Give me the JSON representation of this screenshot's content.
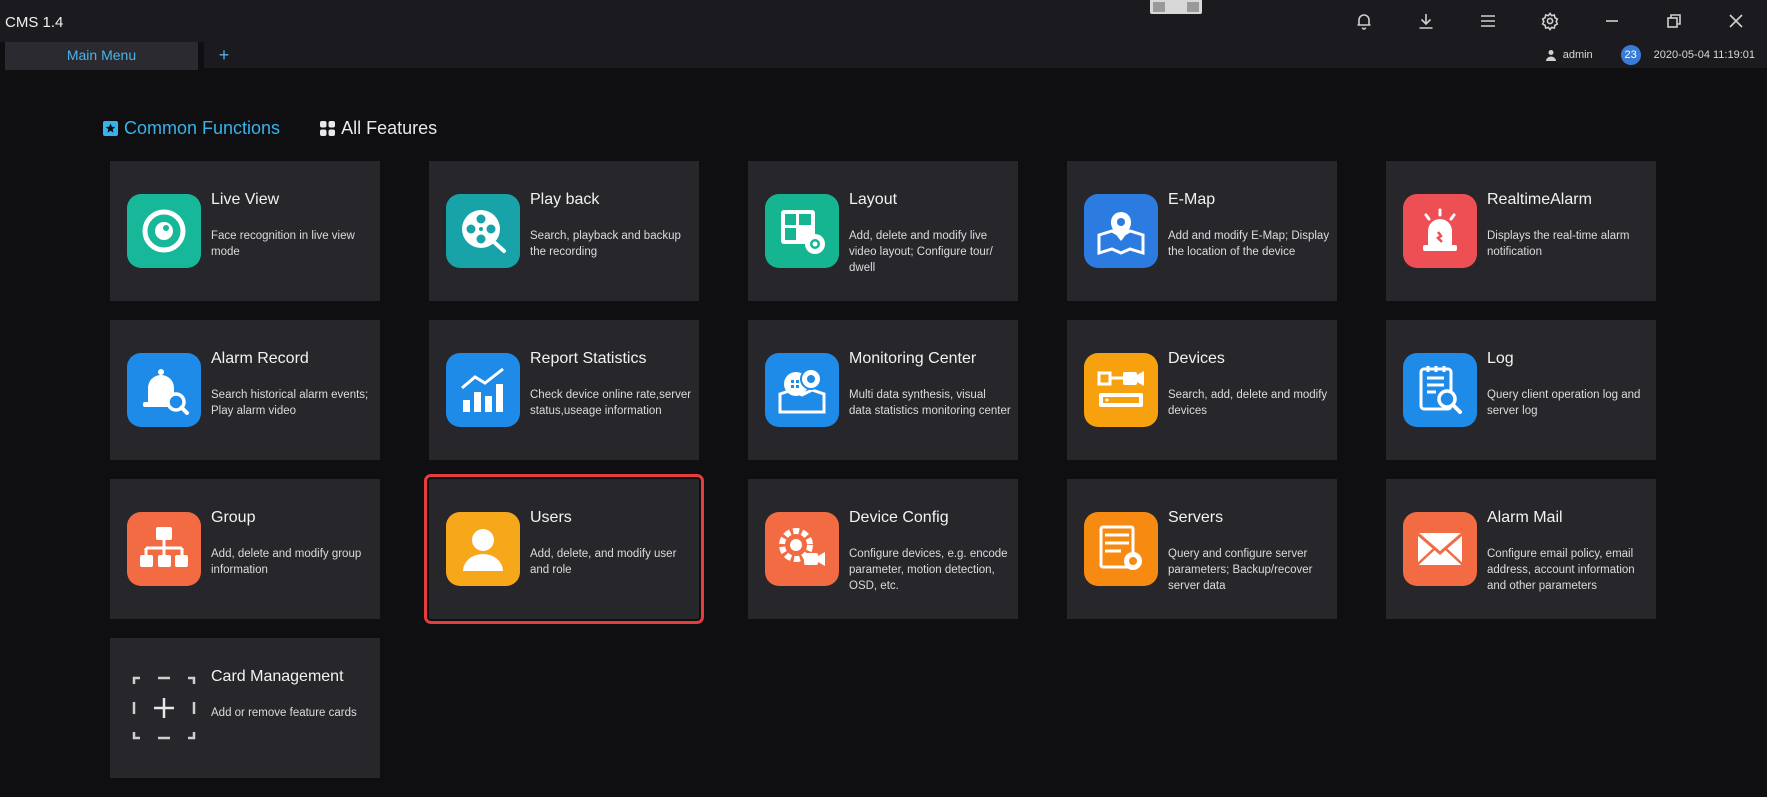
{
  "window": {
    "title": "CMS 1.4"
  },
  "toolbar_icons": [
    "bell-icon",
    "download-icon",
    "menu-icon",
    "settings-icon",
    "minimize-icon",
    "restore-icon",
    "close-icon"
  ],
  "tabs": {
    "main_label": "Main Menu",
    "add_label": "+"
  },
  "status": {
    "user": "admin",
    "badge_count": "23",
    "datetime": "2020-05-04 11:19:01"
  },
  "sections": {
    "common": "Common Functions",
    "all": "All Features"
  },
  "colors": {
    "accent": "#38b2ea",
    "selection": "#e53c3c",
    "card_bg": "#26262b"
  },
  "cards": [
    {
      "title": "Live View",
      "desc": "Face recognition in live view mode",
      "icon": "live-view-icon",
      "color": "#17b89a"
    },
    {
      "title": "Play back",
      "desc": "Search, playback and backup the recording",
      "icon": "film-reel-icon",
      "color": "#17a3a8"
    },
    {
      "title": "Layout",
      "desc": "Add, delete and modify live video layout; Configure tour/ dwell",
      "icon": "layout-gear-icon",
      "color": "#16b592"
    },
    {
      "title": "E-Map",
      "desc": "Add and modify E-Map; Display the location of the device",
      "icon": "map-pin-icon",
      "color": "#2c7be0"
    },
    {
      "title": "RealtimeAlarm",
      "desc": "Displays the real-time alarm notification",
      "icon": "alarm-siren-icon",
      "color": "#ee4f55"
    },
    {
      "title": "Alarm Record",
      "desc": "Search historical alarm events; Play alarm video",
      "icon": "bell-search-icon",
      "color": "#1f8be8"
    },
    {
      "title": "Report Statistics",
      "desc": "Check device online rate,server status,useage information",
      "icon": "bar-chart-icon",
      "color": "#1f8be8"
    },
    {
      "title": "Monitoring Center",
      "desc": "Multi data synthesis, visual data statistics monitoring center",
      "icon": "monitoring-center-icon",
      "color": "#1f8be8"
    },
    {
      "title": "Devices",
      "desc": "Search, add, delete and modify devices",
      "icon": "device-camera-icon",
      "color": "#f7a10f"
    },
    {
      "title": "Log",
      "desc": "Query client operation log and server log",
      "icon": "log-search-icon",
      "color": "#1f8be8"
    },
    {
      "title": "Group",
      "desc": "Add, delete and modify group information",
      "icon": "group-tree-icon",
      "color": "#f26b43"
    },
    {
      "title": "Users",
      "desc": "Add, delete, and modify user and role",
      "icon": "user-icon",
      "color": "#f7a71a"
    },
    {
      "title": "Device Config",
      "desc": "Configure devices, e.g. encode parameter, motion detection, OSD, etc.",
      "icon": "device-config-icon",
      "color": "#f26b43"
    },
    {
      "title": "Servers",
      "desc": "Query and configure server parameters; Backup/recover server data",
      "icon": "server-gear-icon",
      "color": "#f78b12"
    },
    {
      "title": "Alarm Mail",
      "desc": "Configure email policy, email address, account information and other parameters",
      "icon": "mail-icon",
      "color": "#f26b43"
    },
    {
      "title": "Card Management",
      "desc": "Add or remove feature cards",
      "icon": "add-card-icon",
      "color": ""
    }
  ]
}
